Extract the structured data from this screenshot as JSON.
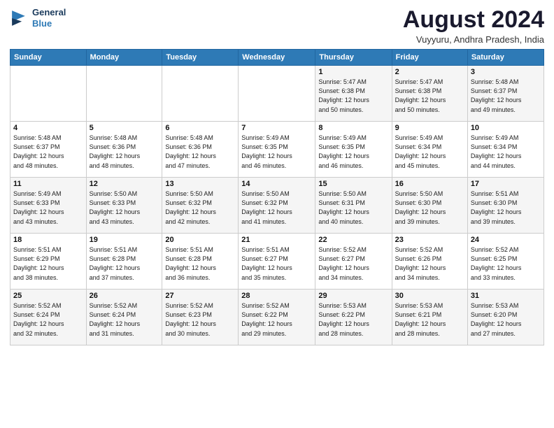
{
  "logo": {
    "line1": "General",
    "line2": "Blue"
  },
  "title": "August 2024",
  "subtitle": "Vuyyuru, Andhra Pradesh, India",
  "header": {
    "days": [
      "Sunday",
      "Monday",
      "Tuesday",
      "Wednesday",
      "Thursday",
      "Friday",
      "Saturday"
    ]
  },
  "weeks": [
    [
      {
        "day": "",
        "info": ""
      },
      {
        "day": "",
        "info": ""
      },
      {
        "day": "",
        "info": ""
      },
      {
        "day": "",
        "info": ""
      },
      {
        "day": "1",
        "info": "Sunrise: 5:47 AM\nSunset: 6:38 PM\nDaylight: 12 hours\nand 50 minutes."
      },
      {
        "day": "2",
        "info": "Sunrise: 5:47 AM\nSunset: 6:38 PM\nDaylight: 12 hours\nand 50 minutes."
      },
      {
        "day": "3",
        "info": "Sunrise: 5:48 AM\nSunset: 6:37 PM\nDaylight: 12 hours\nand 49 minutes."
      }
    ],
    [
      {
        "day": "4",
        "info": "Sunrise: 5:48 AM\nSunset: 6:37 PM\nDaylight: 12 hours\nand 48 minutes."
      },
      {
        "day": "5",
        "info": "Sunrise: 5:48 AM\nSunset: 6:36 PM\nDaylight: 12 hours\nand 48 minutes."
      },
      {
        "day": "6",
        "info": "Sunrise: 5:48 AM\nSunset: 6:36 PM\nDaylight: 12 hours\nand 47 minutes."
      },
      {
        "day": "7",
        "info": "Sunrise: 5:49 AM\nSunset: 6:35 PM\nDaylight: 12 hours\nand 46 minutes."
      },
      {
        "day": "8",
        "info": "Sunrise: 5:49 AM\nSunset: 6:35 PM\nDaylight: 12 hours\nand 46 minutes."
      },
      {
        "day": "9",
        "info": "Sunrise: 5:49 AM\nSunset: 6:34 PM\nDaylight: 12 hours\nand 45 minutes."
      },
      {
        "day": "10",
        "info": "Sunrise: 5:49 AM\nSunset: 6:34 PM\nDaylight: 12 hours\nand 44 minutes."
      }
    ],
    [
      {
        "day": "11",
        "info": "Sunrise: 5:49 AM\nSunset: 6:33 PM\nDaylight: 12 hours\nand 43 minutes."
      },
      {
        "day": "12",
        "info": "Sunrise: 5:50 AM\nSunset: 6:33 PM\nDaylight: 12 hours\nand 43 minutes."
      },
      {
        "day": "13",
        "info": "Sunrise: 5:50 AM\nSunset: 6:32 PM\nDaylight: 12 hours\nand 42 minutes."
      },
      {
        "day": "14",
        "info": "Sunrise: 5:50 AM\nSunset: 6:32 PM\nDaylight: 12 hours\nand 41 minutes."
      },
      {
        "day": "15",
        "info": "Sunrise: 5:50 AM\nSunset: 6:31 PM\nDaylight: 12 hours\nand 40 minutes."
      },
      {
        "day": "16",
        "info": "Sunrise: 5:50 AM\nSunset: 6:30 PM\nDaylight: 12 hours\nand 39 minutes."
      },
      {
        "day": "17",
        "info": "Sunrise: 5:51 AM\nSunset: 6:30 PM\nDaylight: 12 hours\nand 39 minutes."
      }
    ],
    [
      {
        "day": "18",
        "info": "Sunrise: 5:51 AM\nSunset: 6:29 PM\nDaylight: 12 hours\nand 38 minutes."
      },
      {
        "day": "19",
        "info": "Sunrise: 5:51 AM\nSunset: 6:28 PM\nDaylight: 12 hours\nand 37 minutes."
      },
      {
        "day": "20",
        "info": "Sunrise: 5:51 AM\nSunset: 6:28 PM\nDaylight: 12 hours\nand 36 minutes."
      },
      {
        "day": "21",
        "info": "Sunrise: 5:51 AM\nSunset: 6:27 PM\nDaylight: 12 hours\nand 35 minutes."
      },
      {
        "day": "22",
        "info": "Sunrise: 5:52 AM\nSunset: 6:27 PM\nDaylight: 12 hours\nand 34 minutes."
      },
      {
        "day": "23",
        "info": "Sunrise: 5:52 AM\nSunset: 6:26 PM\nDaylight: 12 hours\nand 34 minutes."
      },
      {
        "day": "24",
        "info": "Sunrise: 5:52 AM\nSunset: 6:25 PM\nDaylight: 12 hours\nand 33 minutes."
      }
    ],
    [
      {
        "day": "25",
        "info": "Sunrise: 5:52 AM\nSunset: 6:24 PM\nDaylight: 12 hours\nand 32 minutes."
      },
      {
        "day": "26",
        "info": "Sunrise: 5:52 AM\nSunset: 6:24 PM\nDaylight: 12 hours\nand 31 minutes."
      },
      {
        "day": "27",
        "info": "Sunrise: 5:52 AM\nSunset: 6:23 PM\nDaylight: 12 hours\nand 30 minutes."
      },
      {
        "day": "28",
        "info": "Sunrise: 5:52 AM\nSunset: 6:22 PM\nDaylight: 12 hours\nand 29 minutes."
      },
      {
        "day": "29",
        "info": "Sunrise: 5:53 AM\nSunset: 6:22 PM\nDaylight: 12 hours\nand 28 minutes."
      },
      {
        "day": "30",
        "info": "Sunrise: 5:53 AM\nSunset: 6:21 PM\nDaylight: 12 hours\nand 28 minutes."
      },
      {
        "day": "31",
        "info": "Sunrise: 5:53 AM\nSunset: 6:20 PM\nDaylight: 12 hours\nand 27 minutes."
      }
    ]
  ]
}
